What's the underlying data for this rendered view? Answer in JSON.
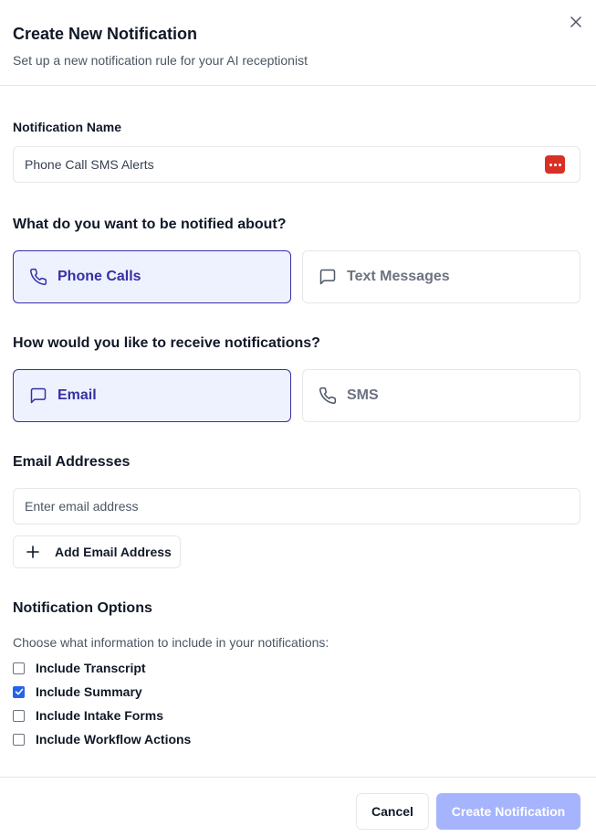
{
  "dialog": {
    "title": "Create New Notification",
    "subtitle": "Set up a new notification rule for your AI receptionist",
    "close_icon": "close-icon"
  },
  "name_field": {
    "label": "Notification Name",
    "value": "Phone Call SMS Alerts",
    "autofill_icon": "password-manager-icon"
  },
  "event_type": {
    "heading": "What do you want to be notified about?",
    "options": [
      {
        "label": "Phone Calls",
        "icon": "phone-icon",
        "selected": true
      },
      {
        "label": "Text Messages",
        "icon": "message-icon",
        "selected": false
      }
    ]
  },
  "channel": {
    "heading": "How would you like to receive notifications?",
    "options": [
      {
        "label": "Email",
        "icon": "message-icon",
        "selected": true
      },
      {
        "label": "SMS",
        "icon": "phone-icon",
        "selected": false
      }
    ]
  },
  "emails": {
    "heading": "Email Addresses",
    "placeholder": "Enter email address",
    "add_label": "Add Email Address",
    "add_icon": "plus-icon"
  },
  "options": {
    "heading": "Notification Options",
    "description": "Choose what information to include in your notifications:",
    "items": [
      {
        "label": "Include Transcript",
        "checked": false
      },
      {
        "label": "Include Summary",
        "checked": true
      },
      {
        "label": "Include Intake Forms",
        "checked": false
      },
      {
        "label": "Include Workflow Actions",
        "checked": false
      }
    ]
  },
  "footer": {
    "cancel_label": "Cancel",
    "create_label": "Create Notification"
  },
  "colors": {
    "accent": "#3730a3",
    "selected_bg": "#eef2ff",
    "create_button_disabled": "#a5b4fc",
    "checkbox_checked": "#2563eb",
    "autofill_icon": "#d93025"
  }
}
